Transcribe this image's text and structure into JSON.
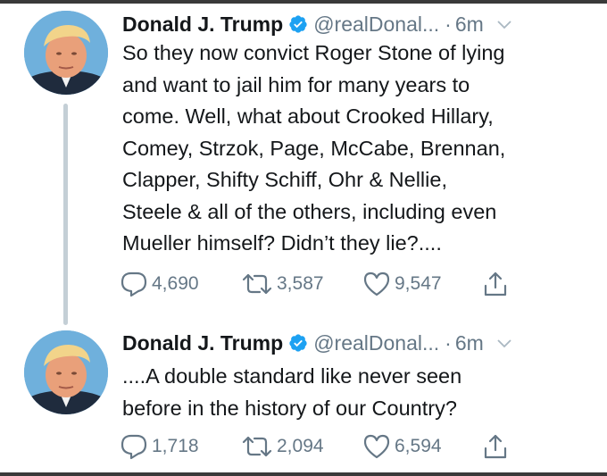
{
  "tweets": [
    {
      "author": {
        "name": "Donald J. Trump",
        "handle": "@realDonal...",
        "verified": true
      },
      "separator": "·",
      "time": "6m",
      "text": "So they now convict Roger Stone of lying\nand want to jail him for many years to\ncome. Well, what about Crooked Hillary,\nComey, Strzok, Page, McCabe, Brennan,\nClapper, Shifty Schiff, Ohr & Nellie,\nSteele & all of the others, including even\nMueller himself? Didn’t they lie?....",
      "stats": {
        "replies": "4,690",
        "retweets": "3,587",
        "likes": "9,547"
      }
    },
    {
      "author": {
        "name": "Donald J. Trump",
        "handle": "@realDonal...",
        "verified": true
      },
      "separator": "·",
      "time": "6m",
      "text": "....A double standard like never seen\nbefore in the history of our Country?",
      "stats": {
        "replies": "1,718",
        "retweets": "2,094",
        "likes": "6,594"
      }
    }
  ],
  "icons": {
    "verified": "verified-badge-icon",
    "menu": "chevron-down-icon",
    "reply": "reply-icon",
    "retweet": "retweet-icon",
    "like": "heart-icon",
    "share": "share-icon"
  },
  "colors": {
    "text": "#14171a",
    "secondary": "#657786",
    "verified": "#1da1f2",
    "thread_line": "#c4cfd6"
  }
}
